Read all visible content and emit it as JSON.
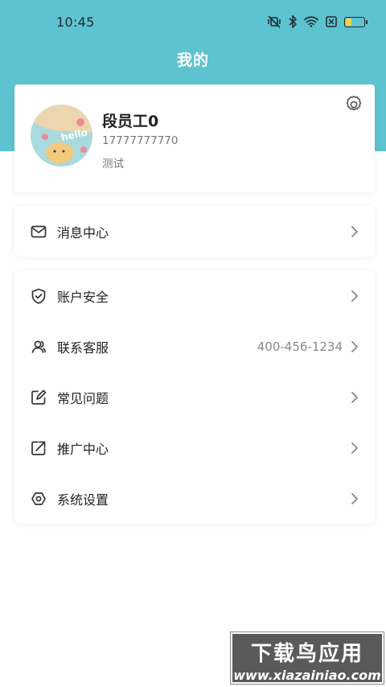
{
  "status_bar": {
    "time": "10:45",
    "icons": [
      "mute-vibrate-icon",
      "bluetooth-icon",
      "wifi-icon",
      "no-sim-icon",
      "battery-icon"
    ],
    "battery_level": 0.3
  },
  "header": {
    "title": "我的",
    "background_color": "#5ec3d0"
  },
  "profile": {
    "name": "段员工0",
    "phone": "17777777770",
    "note": "测试",
    "avatar_text": "hello"
  },
  "menu_group_1": [
    {
      "label": "消息中心",
      "icon": "mail-icon"
    }
  ],
  "menu_group_2": [
    {
      "label": "账户安全",
      "icon": "shield-check-icon"
    },
    {
      "label": "联系客服",
      "icon": "contacts-icon",
      "value": "400-456-1234"
    },
    {
      "label": "常见问题",
      "icon": "edit-square-icon"
    },
    {
      "label": "推广中心",
      "icon": "share-external-icon"
    },
    {
      "label": "系统设置",
      "icon": "hexagon-settings-icon"
    }
  ],
  "watermark": {
    "title": "下载鸟应用",
    "url": "www.xiazainiao.com"
  }
}
